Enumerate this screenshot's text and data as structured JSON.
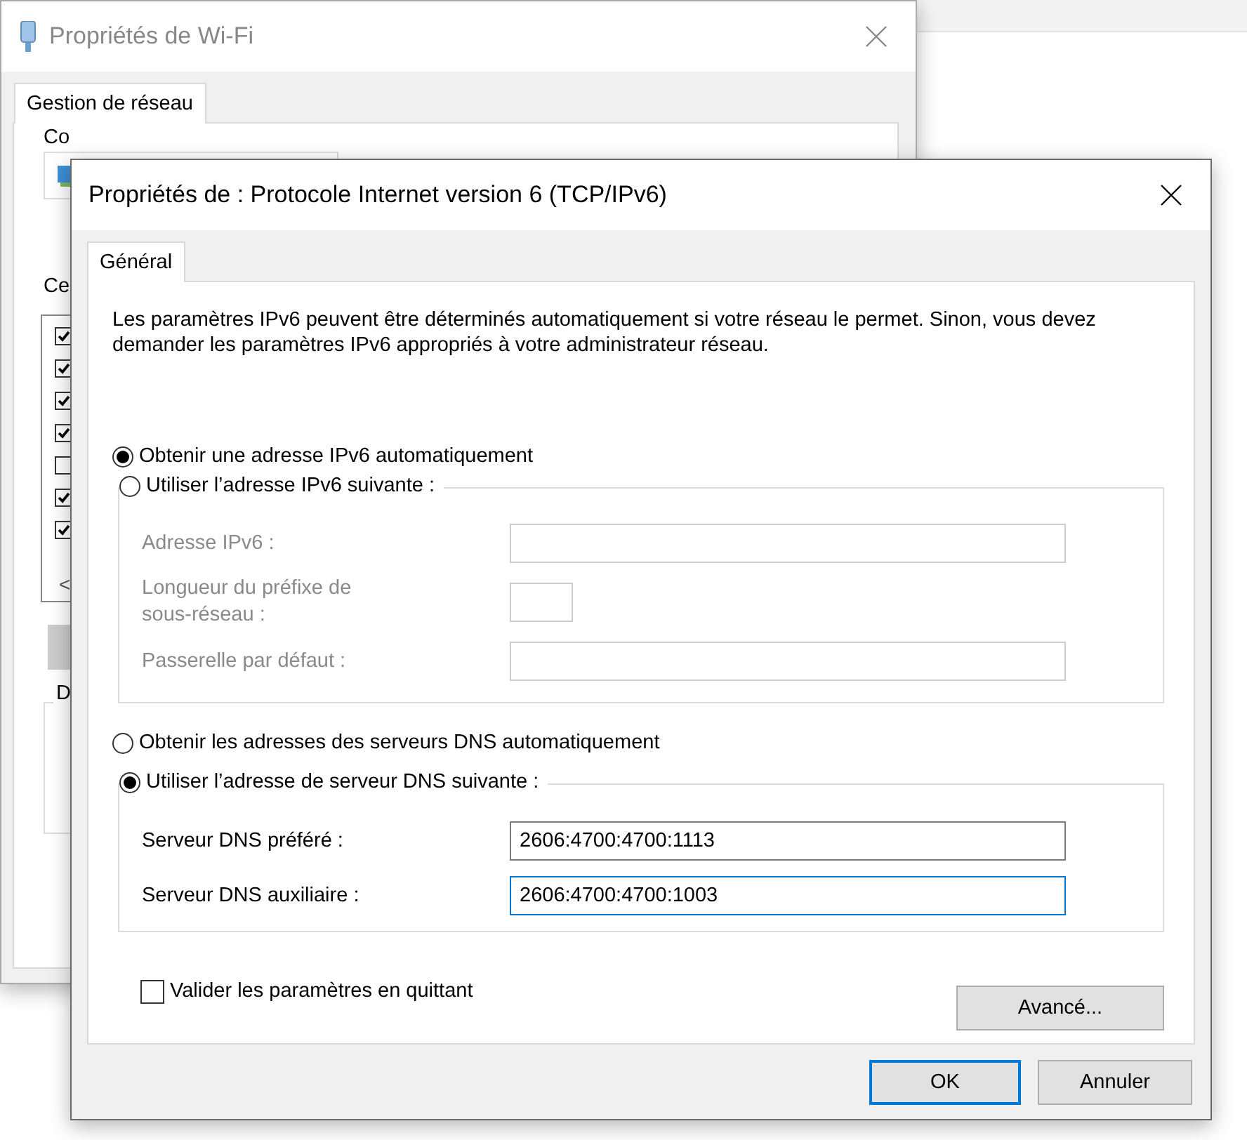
{
  "background_window": {
    "title": "Propriétés de Wi-Fi",
    "tabs": [
      {
        "label": "Gestion de réseau",
        "selected": true
      }
    ],
    "labels": [
      "Co",
      "Ce",
      "D"
    ],
    "components": [
      {
        "checked": true
      },
      {
        "checked": true
      },
      {
        "checked": true
      },
      {
        "checked": true
      },
      {
        "checked": false
      },
      {
        "checked": true
      },
      {
        "checked": true
      }
    ],
    "scroll_arrow": "<"
  },
  "dialog": {
    "title": "Propriétés de : Protocole Internet version 6 (TCP/IPv6)",
    "tabs": [
      {
        "label": "Général",
        "selected": true
      }
    ],
    "description": "Les paramètres IPv6 peuvent être déterminés automatiquement si votre réseau le permet. Sinon, vous devez demander les paramètres IPv6 appropriés à votre administrateur réseau.",
    "ip_auto": {
      "label": "Obtenir une adresse IPv6 automatiquement",
      "selected": true
    },
    "ip_manual": {
      "label": "Utiliser l’adresse IPv6 suivante :",
      "selected": false
    },
    "ip_fields": [
      {
        "label": "Adresse IPv6 :",
        "kind": "wide",
        "disabled": true
      },
      {
        "label": "Longueur du préfixe de sous-réseau :",
        "kind": "short",
        "disabled": true
      },
      {
        "label": "Passerelle par défaut :",
        "kind": "wide",
        "disabled": true
      }
    ],
    "dns_auto": {
      "label": "Obtenir les adresses des serveurs DNS automatiquement",
      "selected": false
    },
    "dns_manual": {
      "label": "Utiliser l’adresse de serveur DNS suivante :",
      "selected": true
    },
    "dns_fields": [
      {
        "label": "Serveur DNS préféré :",
        "value": "2606:4700:4700:1113",
        "focused": false,
        "disabled": false
      },
      {
        "label": "Serveur DNS auxiliaire :",
        "value": "2606:4700:4700:1003",
        "focused": true,
        "disabled": false
      }
    ],
    "validate": {
      "label": "Valider les paramètres en quittant",
      "checked": false
    },
    "advanced_button": "Avancé...",
    "buttons": [
      {
        "label": "OK",
        "default": true
      },
      {
        "label": "Annuler",
        "default": false
      }
    ]
  }
}
